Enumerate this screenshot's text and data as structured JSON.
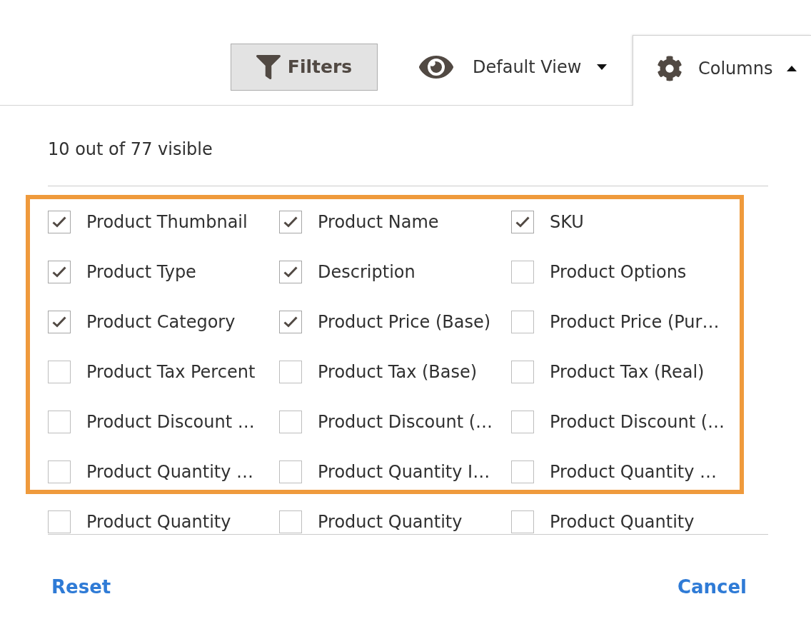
{
  "toolbar": {
    "filters_button": {
      "label": "Filters"
    },
    "view_selector": {
      "label": "Default View",
      "expanded": false
    },
    "columns_button": {
      "label": "Columns",
      "expanded": true
    }
  },
  "columns_panel": {
    "summary": "10 out of 77 visible",
    "options_highlighted": true,
    "options": [
      {
        "label": "Product Thumbnail",
        "checked": true
      },
      {
        "label": "Product Name",
        "checked": true
      },
      {
        "label": "SKU",
        "checked": true
      },
      {
        "label": "Product Type",
        "checked": true
      },
      {
        "label": "Description",
        "checked": true
      },
      {
        "label": "Product Options",
        "checked": false
      },
      {
        "label": "Product Category",
        "checked": true
      },
      {
        "label": "Product Price (Base)",
        "checked": true
      },
      {
        "label": "Product Price (Pur…",
        "checked": false
      },
      {
        "label": "Product Tax Percent",
        "checked": false
      },
      {
        "label": "Product Tax (Base)",
        "checked": false
      },
      {
        "label": "Product Tax (Real)",
        "checked": false
      },
      {
        "label": "Product Discount …",
        "checked": false
      },
      {
        "label": "Product Discount (…",
        "checked": false
      },
      {
        "label": "Product Discount (…",
        "checked": false
      },
      {
        "label": "Product Quantity …",
        "checked": false
      },
      {
        "label": "Product Quantity I…",
        "checked": false
      },
      {
        "label": "Product Quantity …",
        "checked": false
      },
      {
        "label": "Product Quantity",
        "checked": false
      },
      {
        "label": "Product Quantity",
        "checked": false
      },
      {
        "label": "Product Quantity",
        "checked": false
      }
    ],
    "actions": {
      "reset": "Reset",
      "cancel": "Cancel"
    }
  }
}
